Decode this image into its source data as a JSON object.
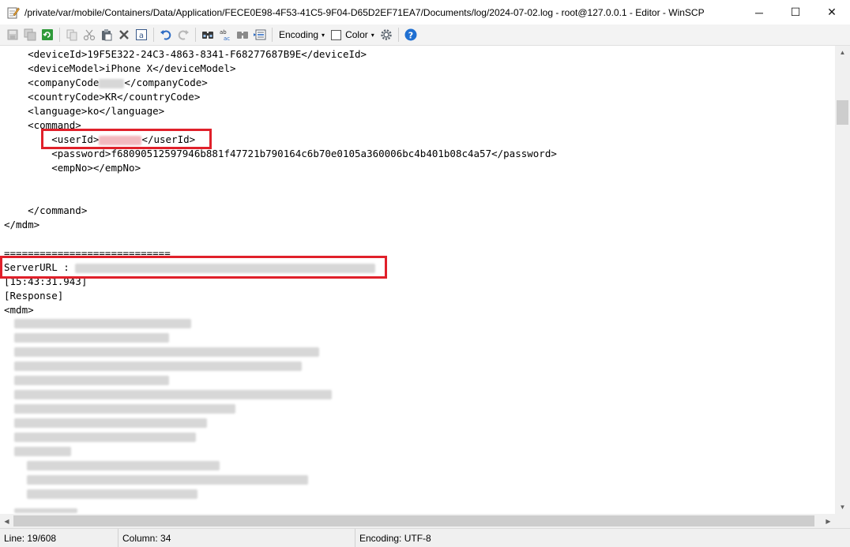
{
  "window": {
    "title": "/private/var/mobile/Containers/Data/Application/FECE0E98-4F53-41C5-9F04-D65D2EF71EA7/Documents/log/2024-07-02.log - root@127.0.0.1 - Editor - WinSCP",
    "minimize": "─",
    "maximize": "☐",
    "close": "✕"
  },
  "toolbar": {
    "encoding_label": "Encoding",
    "color_label": "Color",
    "dropdown_arrow": "▾"
  },
  "editor": {
    "lines": [
      "    <deviceId>19F5E322-24C3-4863-8341-F68277687B9E</deviceId>",
      "    <deviceModel>iPhone X</deviceModel>",
      "    <companyCode",
      "</companyCode>",
      "    <countryCode>KR</countryCode>",
      "    <language>ko</language>",
      "    <command>",
      "        <userId>",
      "</userId>",
      "        <password>f68090512597946b881f47721b790164c6b70e0105a360006bc4b401b08c4a57</password>",
      "        <empNo></empNo>",
      "    </command>",
      "</mdm>",
      "============================",
      "ServerURL : ",
      "[15:43:31.943]",
      "[Response]",
      "<mdm>"
    ]
  },
  "status": {
    "line": "Line: 19/608",
    "column": "Column: 34",
    "encoding": "Encoding: UTF-8"
  },
  "colors": {
    "highlight_box": "#e0202a",
    "help_icon": "#1f6fd1",
    "undo_icon": "#2d6bc4"
  }
}
